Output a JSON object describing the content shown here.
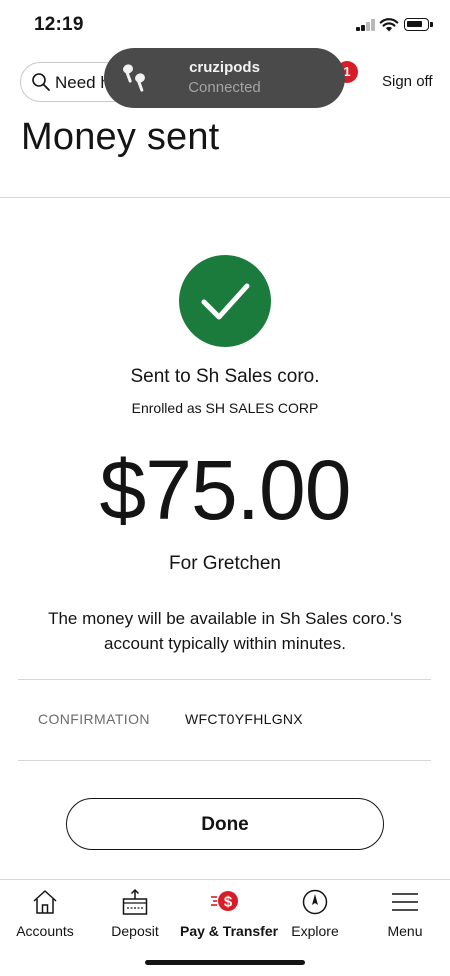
{
  "status_bar": {
    "time": "12:19"
  },
  "header": {
    "search_placeholder": "Need h",
    "notification_count": "1",
    "sign_off_label": "Sign off"
  },
  "toast": {
    "device_name": "cruzipods",
    "status": "Connected"
  },
  "page": {
    "title": "Money sent"
  },
  "receipt": {
    "sent_to": "Sent to Sh Sales coro.",
    "enrolled_as": "Enrolled as SH SALES CORP",
    "amount": "$75.00",
    "memo": "For Gretchen",
    "availability_note": "The money will be available in Sh Sales coro.'s account typically within minutes.",
    "confirmation_label": "CONFIRMATION",
    "confirmation_value": "WFCT0YFHLGNX"
  },
  "actions": {
    "done_label": "Done"
  },
  "tab_bar": {
    "items": [
      {
        "label": "Accounts",
        "icon": "home-icon"
      },
      {
        "label": "Deposit",
        "icon": "deposit-icon"
      },
      {
        "label": "Pay & Transfer",
        "icon": "pay-transfer-icon"
      },
      {
        "label": "Explore",
        "icon": "compass-icon"
      },
      {
        "label": "Menu",
        "icon": "menu-icon"
      }
    ],
    "active_index": 2
  },
  "colors": {
    "success_green": "#1b7b3c",
    "brand_red": "#d71e28",
    "toast_bg": "#4a4a4a",
    "text": "#141414",
    "muted_text": "#6b6b6b"
  }
}
